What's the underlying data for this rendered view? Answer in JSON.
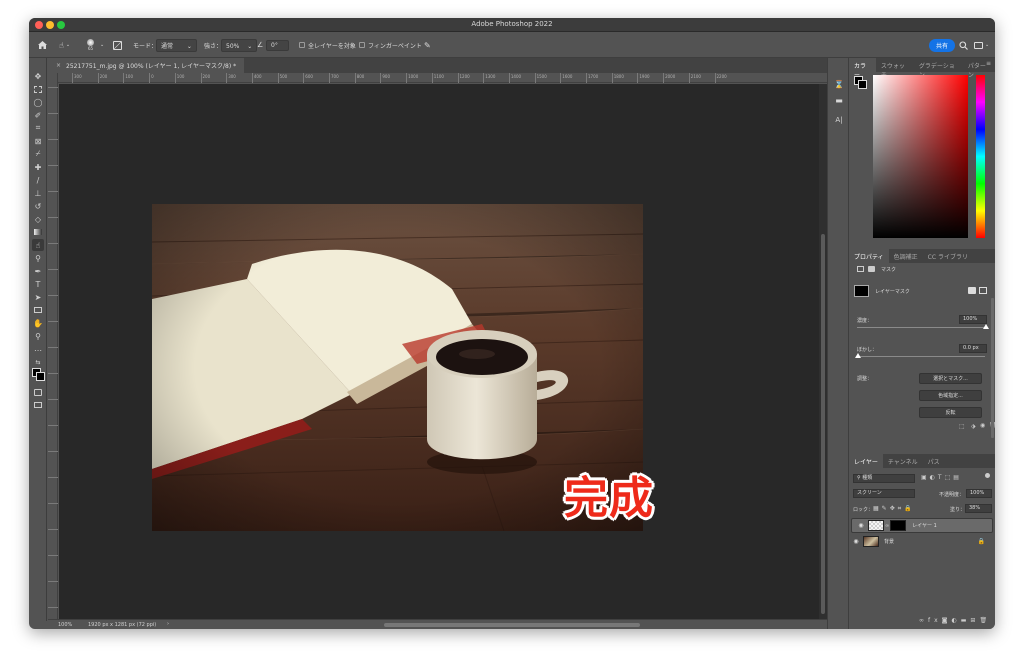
{
  "window": {
    "title": "Adobe Photoshop 2022"
  },
  "options_bar": {
    "brush_size": "65",
    "mode_label": "モード：",
    "mode_value": "通常",
    "strength_label": "強さ：",
    "strength_value": "50%",
    "angle_value": "0°",
    "sample_all_label": "全レイヤーを対象",
    "finger_paint_label": "フィンガーペイント",
    "share_label": "共有"
  },
  "document": {
    "tab_label": "25217751_m.jpg @ 100% (レイヤー 1, レイヤーマスク/8) *",
    "overlay_text": "完成",
    "ruler_labels": [
      "300",
      "200",
      "100",
      "0",
      "100",
      "200",
      "300",
      "400",
      "500",
      "600",
      "700",
      "800",
      "900",
      "1000",
      "1100",
      "1200",
      "1300",
      "1400",
      "1500",
      "1600",
      "1700",
      "1800",
      "1900",
      "2000",
      "2100",
      "2200"
    ]
  },
  "status_bar": {
    "zoom": "100%",
    "doc_info": "1920 px x 1281 px (72 ppi)",
    "arrow": "›"
  },
  "color_panel": {
    "tabs": [
      "カラー",
      "スウォッチ",
      "グラデーション",
      "パターン"
    ]
  },
  "properties_panel": {
    "tabs": [
      "プロパティ",
      "色調補正",
      "CC ライブラリ"
    ],
    "mask_header": "マスク",
    "mask_type": "レイヤーマスク",
    "density_label": "濃度：",
    "density_value": "100%",
    "feather_label": "ぼかし：",
    "feather_value": "0.0 px",
    "adjust_label": "調整：",
    "select_mask_btn": "選択とマスク...",
    "color_range_btn": "色域指定...",
    "invert_btn": "反転"
  },
  "layers_panel": {
    "tabs": [
      "レイヤー",
      "チャンネル",
      "パス"
    ],
    "filter_kind": "種類",
    "blend_mode": "スクリーン",
    "opacity_label": "不透明度：",
    "opacity_value": "100%",
    "lock_label": "ロック：",
    "fill_label": "塗り：",
    "fill_value": "38%",
    "layers": [
      {
        "name": "レイヤー 1"
      },
      {
        "name": "背景"
      }
    ]
  },
  "colors": {
    "canvas_bg": "#282828",
    "panel_bg": "#535353",
    "accent": "#1473e6",
    "overlay_text": "#ee2a1a"
  }
}
